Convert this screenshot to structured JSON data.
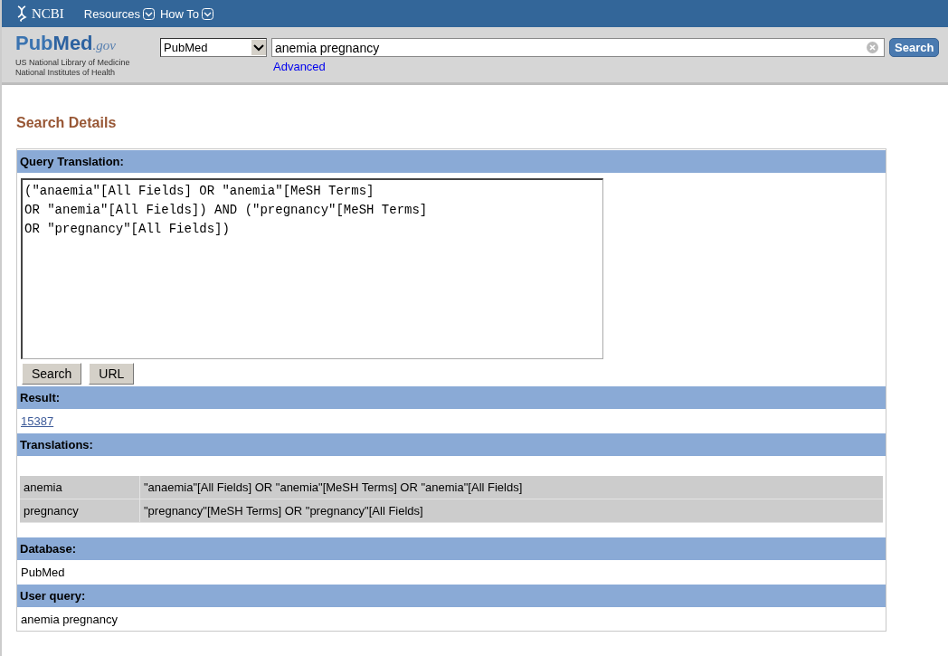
{
  "top_bar": {
    "brand": "NCBI",
    "menus": [
      {
        "label": "Resources"
      },
      {
        "label": "How To"
      }
    ]
  },
  "masthead": {
    "logo_left": "Pub",
    "logo_right": "Med",
    "logo_suffix": ".gov",
    "org_lines": [
      "US National Library of Medicine",
      "National Institutes of Health"
    ],
    "database_select": "PubMed",
    "search_value": "anemia pregnancy",
    "search_button": "Search",
    "advanced_link": "Advanced"
  },
  "page_title": "Search Details",
  "sections": [
    {
      "kind": "query",
      "heading": "Query Translation:",
      "text": "(\"anaemia\"[All Fields] OR \"anemia\"[MeSH Terms]\nOR \"anemia\"[All Fields]) AND (\"pregnancy\"[MeSH Terms]\nOR \"pregnancy\"[All Fields])",
      "buttons": [
        "Search",
        "URL"
      ]
    },
    {
      "kind": "link",
      "heading": "Result:",
      "text": "15387"
    },
    {
      "kind": "table",
      "heading": "Translations:",
      "rows": [
        {
          "term": "anemia",
          "translation": "\"anaemia\"[All Fields] OR \"anemia\"[MeSH Terms] OR \"anemia\"[All Fields]"
        },
        {
          "term": "pregnancy",
          "translation": "\"pregnancy\"[MeSH Terms] OR \"pregnancy\"[All Fields]"
        }
      ]
    },
    {
      "kind": "text",
      "heading": "Database:",
      "text": "PubMed"
    },
    {
      "kind": "text",
      "heading": "User query:",
      "text": "anemia pregnancy"
    }
  ]
}
